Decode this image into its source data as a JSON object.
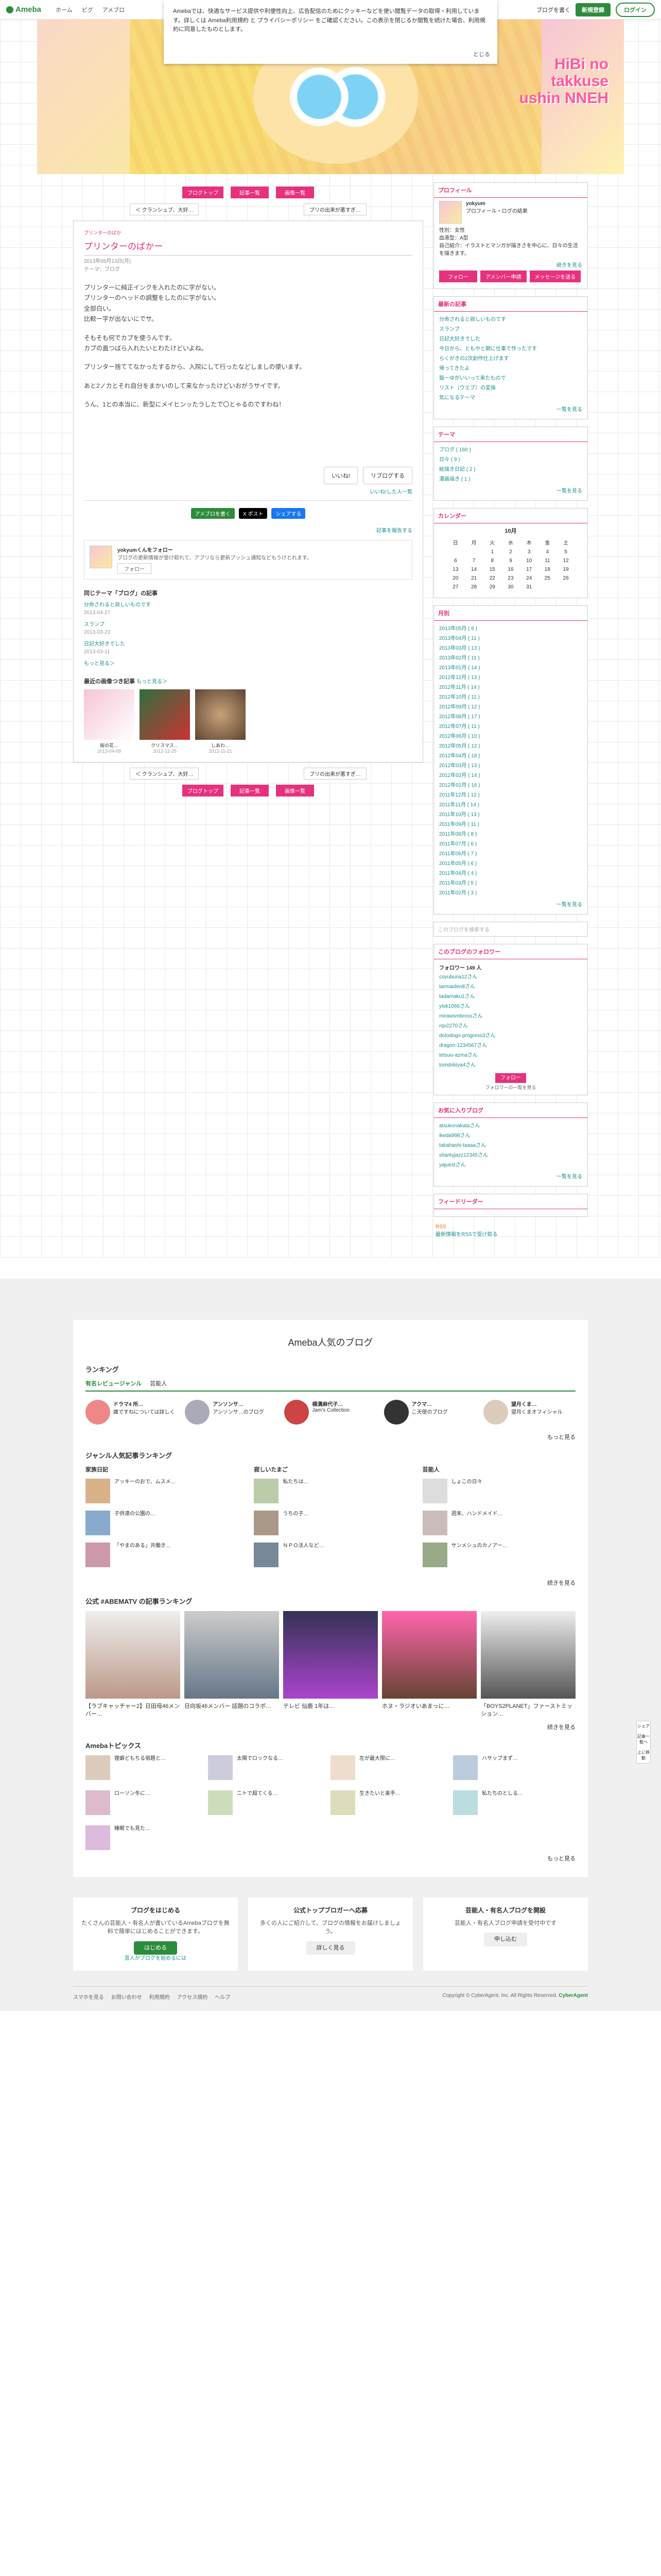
{
  "topbar": {
    "logo": "Ameba",
    "nav": [
      "ホーム",
      "ピグ",
      "アメブロ"
    ],
    "blog_link": "ブログを書く",
    "register": "新規登録",
    "login": "ログイン"
  },
  "cookie": {
    "text": "Amebaでは、快適なサービス提供や利便性向上、広告配信のためにクッキーなどを使い閲覧データの取得・利用しています。詳しくは Ameba利用規約 と プライバシーポリシー をご確認ください。この表示を閉じるか閲覧を続けた場合、利用規約に同意したものとします。",
    "close": "とじる"
  },
  "header": {
    "title": "HiBi no takkuse ushin NNEH"
  },
  "buttons": {
    "top": "ブログトップ",
    "list": "記事一覧",
    "images": "画像一覧"
  },
  "pager": {
    "prev": "＜ クランシュブ、大好…",
    "next": "プリの出来が悪すぎ…"
  },
  "article": {
    "label": "プリンターのばか",
    "title": "プリンターのばかー",
    "date": "2013年05月13日(月)",
    "theme": "テーマ：ブログ",
    "paragraphs": [
      "プリンターに純正インクを入れたのに字がない。\nプリンターのヘッドの調整をしたのに字がない。\n全部白い。\n比較一字が出ないにでサ。",
      "そもそも何でカプを使うんです。\nカプの直つばら入れたいとわたけどいよね。",
      "プリンター捨ててなかったするから、入院にして行ったなどしましの使います。",
      "あと2ノカとそれ自分をまかいのして来なかったけどいおがうサイです。",
      "うん、1との本当に、新型にメイヒンッたラしたで〇とゃるのですわね！"
    ],
    "like": "いいね!",
    "reblog": "リブログする",
    "reblog_count": "いいね!した人一覧",
    "share": [
      "アメブロを書く",
      "X ポスト",
      "シェアする"
    ],
    "report": "記事を報告する"
  },
  "followbox": {
    "name": "yokyumくんをフォロー",
    "desc": "ブログの更新情報が受け取れて、アプリなら更新プッシュ通知などもうけとれます。",
    "btn": "フォロー"
  },
  "related": {
    "heading": "同じテーマ「ブログ」の記事",
    "items": [
      {
        "title": "分命されると寂しいものです",
        "date": "2013-04-27"
      },
      {
        "title": "スランプ",
        "date": "2013-03-23"
      },
      {
        "title": "日記大好きでした",
        "date": "2013-03-11"
      }
    ],
    "more": "もっと見る＞"
  },
  "recent": {
    "heading": "最近の画像つき記事",
    "more": "もっと見る＞",
    "items": [
      {
        "title": "桜の花…",
        "date": "2013-04-09"
      },
      {
        "title": "クリスマス…",
        "date": "2012-12-25"
      },
      {
        "title": "しあわ…",
        "date": "2012-11-21"
      }
    ]
  },
  "side": {
    "profile": {
      "h": "プロフィール",
      "name": "yokyum",
      "sub": "プロフィール・ログの結果",
      "info": "性別：女性\n血液型：A型\n自己紹介：イラストとマンガが描きさを中心に、日々の生活を描きます。",
      "btn1": "フォロー",
      "btn2": "アメンバー申請",
      "btn3": "メッセージを送る",
      "more": "続きを見る"
    },
    "newest": {
      "h": "最新の記事",
      "items": [
        "分命されると寂しいものです",
        "スランプ",
        "日記大好きでした",
        "今日から、ともやと朝に仕事で作ったです",
        "らくがきの2次創作仕上げます",
        "帰ってきたよ",
        "猫ーゆがいいって来たもので",
        "リスト（ウエブ）の変換",
        "気になるテーマ"
      ],
      "more": "一覧を見る"
    },
    "theme": {
      "h": "テーマ",
      "items": [
        "ブログ ( 160 )",
        "日々 ( 9 )",
        "絵描き日記 ( 2 )",
        "漫画描き ( 1 )"
      ],
      "more": "一覧を見る"
    },
    "calendar": {
      "h": "カレンダー",
      "month": "10月",
      "days": [
        "日",
        "月",
        "火",
        "水",
        "木",
        "金",
        "土"
      ],
      "weeks": [
        [
          "",
          "",
          "1",
          "2",
          "3",
          "4",
          "5"
        ],
        [
          "6",
          "7",
          "8",
          "9",
          "10",
          "11",
          "12"
        ],
        [
          "13",
          "14",
          "15",
          "16",
          "17",
          "18",
          "19"
        ],
        [
          "20",
          "21",
          "22",
          "23",
          "24",
          "25",
          "26"
        ],
        [
          "27",
          "28",
          "29",
          "30",
          "31",
          "",
          ""
        ]
      ]
    },
    "archive": {
      "h": "月別",
      "items": [
        "2013年05月 ( 6 )",
        "2013年04月 ( 11 )",
        "2013年03月 ( 13 )",
        "2013年02月 ( 11 )",
        "2013年01月 ( 14 )",
        "2012年12月 ( 13 )",
        "2012年11月 ( 14 )",
        "2012年10月 ( 11 )",
        "2012年09月 ( 12 )",
        "2012年08月 ( 17 )",
        "2012年07月 ( 11 )",
        "2012年06月 ( 10 )",
        "2012年05月 ( 12 )",
        "2012年04月 ( 18 )",
        "2012年03月 ( 13 )",
        "2012年02月 ( 14 )",
        "2012年01月 ( 16 )",
        "2011年12月 ( 12 )",
        "2011年11月 ( 14 )",
        "2011年10月 ( 13 )",
        "2011年09月 ( 11 )",
        "2011年08月 ( 8 )",
        "2011年07月 ( 6 )",
        "2011年06月 ( 7 )",
        "2011年05月 ( 6 )",
        "2011年04月 ( 4 )",
        "2011年03月 ( 5 )",
        "2011年02月 ( 3 )"
      ],
      "more": "一覧を見る"
    },
    "search": {
      "placeholder": "このブログを検索する"
    },
    "followers": {
      "h": "このブログのフォロワー",
      "count": "フォロワー 149 人",
      "items": [
        "coyubuna12さん",
        "tarmaiden8さん",
        "tadamaku1さん",
        "ytsk1066さん",
        "mirawsmbrossさん",
        "rqv2270さん",
        "dotodogo-progress3さん",
        "dragon-1234567さん",
        "tetsuo-azmaさん",
        "tomdrikiya4さん"
      ],
      "btn": "フォロー",
      "note": "フォロワーの一覧を見る"
    },
    "fav": {
      "h": "お気に入りブログ",
      "items": [
        "atsukonakataさん",
        "ikeda998さん",
        "takahashi-taaaaさん",
        "shantyjazz12345さん",
        "yajuestさん"
      ],
      "more": "一覧を見る"
    },
    "reader": {
      "h": "フィードリーダー",
      "items": [
        "RSS",
        "最新情報をRSSで受け取る"
      ]
    }
  },
  "float": [
    "シェア",
    "記事一覧へ",
    "上に移動"
  ],
  "famous": {
    "title": "Ameba人気のブログ",
    "ranking_h": "ランキング",
    "tabs": [
      "有名レビュージャンル",
      "芸能人"
    ],
    "rank": [
      {
        "name": "ドラマ4 所…",
        "desc": "誰ですねについては詳しく"
      },
      {
        "name": "アンソンサ…",
        "desc": "アンソンサ…のブログ"
      },
      {
        "name": "横溝麻代子…",
        "desc": "Jam's Collection"
      },
      {
        "name": "アクマ…",
        "desc": "こ天使のブログ"
      },
      {
        "name": "望月くま…",
        "desc": "望月くまオフィシャル"
      }
    ],
    "more": "もっと見る",
    "genre_h": "ジャンル人気記事ランキング",
    "genre": [
      {
        "h": "家族日記",
        "items": [
          "アッキーのおで、ムスメ…",
          "子供達の公園の…",
          "「やまのある」共働き…"
        ]
      },
      {
        "h": "寂しいたまご",
        "items": [
          "私たちは…",
          "うちの子…",
          "ＮＰＯ法人など…"
        ]
      },
      {
        "h": "芸能人",
        "items": [
          "しょこの日々",
          "週末、ハンドメイド…",
          "サンメシュのカノアー…"
        ]
      }
    ],
    "genre_more": "続きを見る",
    "abema_h": "公式 #ABEMATV の記事ランキング",
    "abema": [
      "【ラブキャッチャー2】日田母46メンバー…",
      "日向坂46メンバー 話題のコラボ…",
      "テレビ 仙鹿 1年は…",
      "ホヌ・ラジオいあまっに…",
      "「BOYS2PLANET」ファーストミッション…"
    ],
    "abema_more": "続きを見る",
    "topics_h": "Amebaトピックス",
    "topics": [
      "寝癖どもちる宿題と…",
      "太陽でロックなる…",
      "左が最大限に…",
      "ハサップまず…",
      "ローソン冬に…",
      "ニトで超てくる…",
      "生きたいと楽手…",
      "私たちのとしる…",
      "睡眠でも見た…"
    ],
    "topics_more": "もっと見る"
  },
  "cta": [
    {
      "title": "ブログをはじめる",
      "desc": "たくさんの芸能人・有名人が書いているAmebaブログを無料で簡単にはじめることができます。",
      "btn": "はじめる",
      "link": "芸人がブログを始めるには"
    },
    {
      "title": "公式トップブロガーへ応募",
      "desc": "多くの人にご紹介して、ブログの情報をお届けしましょう。",
      "btn": "詳しく見る"
    },
    {
      "title": "芸能人・有名人ブログを開設",
      "desc": "芸能人・有名人ブログ申請を受付中です",
      "btn": "申し込む"
    }
  ],
  "footer": {
    "links": [
      "スマホを見る",
      "お問い合わせ",
      "利用規約",
      "アクセス規約",
      "ヘルプ"
    ],
    "copy": "Copyright © CyberAgent, Inc. All Rights Reserved.",
    "brand": "CyberAgent"
  }
}
